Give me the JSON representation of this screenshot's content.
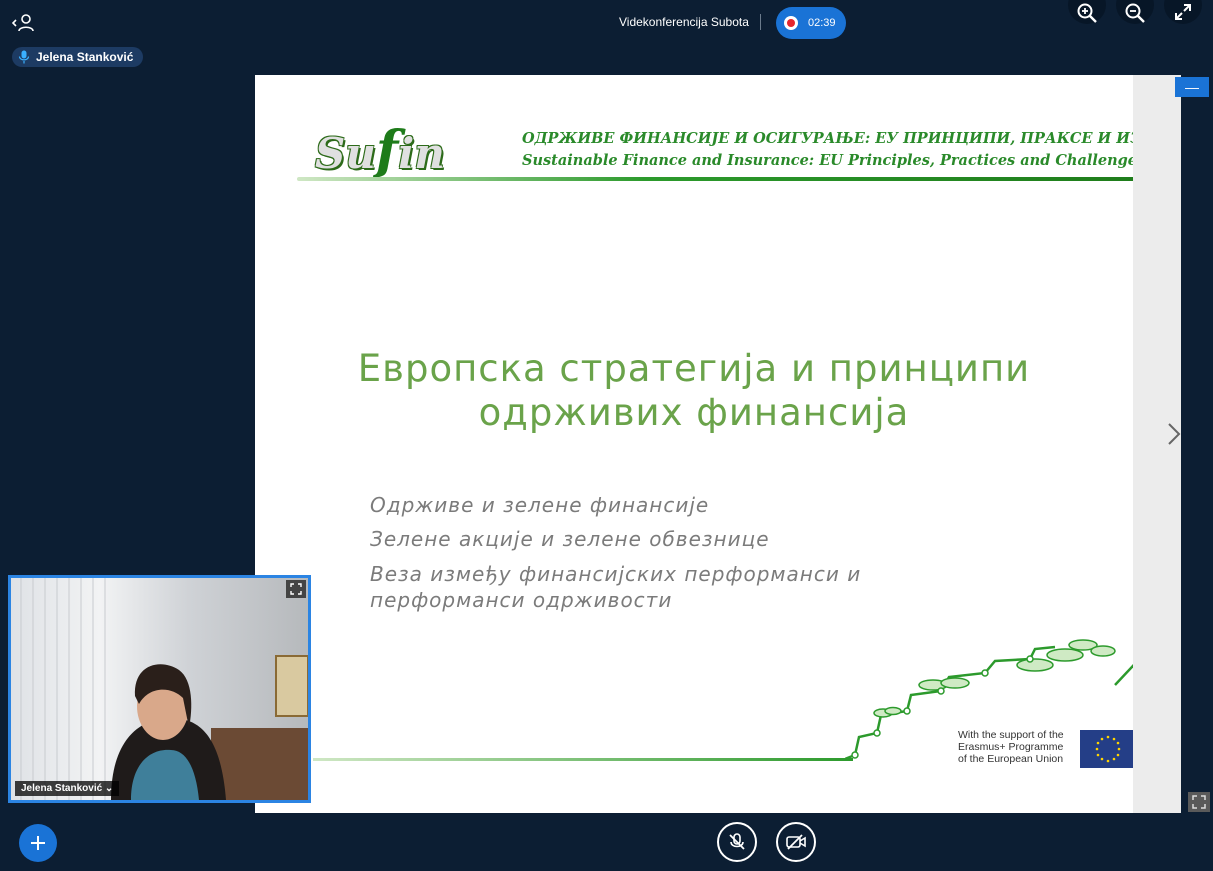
{
  "topbar": {
    "title": "Videkonferencija Subota",
    "recording_time": "02:39"
  },
  "speaker": {
    "name": "Jelena Stanković"
  },
  "slide": {
    "header_sr": "ОДРЖИВЕ ФИНАНСИЈЕ И ОСИГУРАЊЕ: ЕУ ПРИНЦИПИ, ПРАКСЕ И ИЗАЗОВИ",
    "header_en": "Sustainable Finance and Insurance: EU Principles, Practices and Challenges",
    "title_line1": "Европска стратегија и принципи",
    "title_line2": "одрживих финансија",
    "bullets": [
      "Одрживе и зелене финансије",
      "Зелене акције и зелене обвезнице",
      "Веза између финансијских перформанси и перформанси одрживости"
    ],
    "support_line1": "With the support of the",
    "support_line2": "Erasmus+ Programme",
    "support_line3": "of the European Union"
  },
  "video": {
    "name": "Jelena Stanković ⌄"
  },
  "colors": {
    "accent": "#1a73d6",
    "background": "#0c1e33",
    "slide_green": "#6aa34a"
  }
}
